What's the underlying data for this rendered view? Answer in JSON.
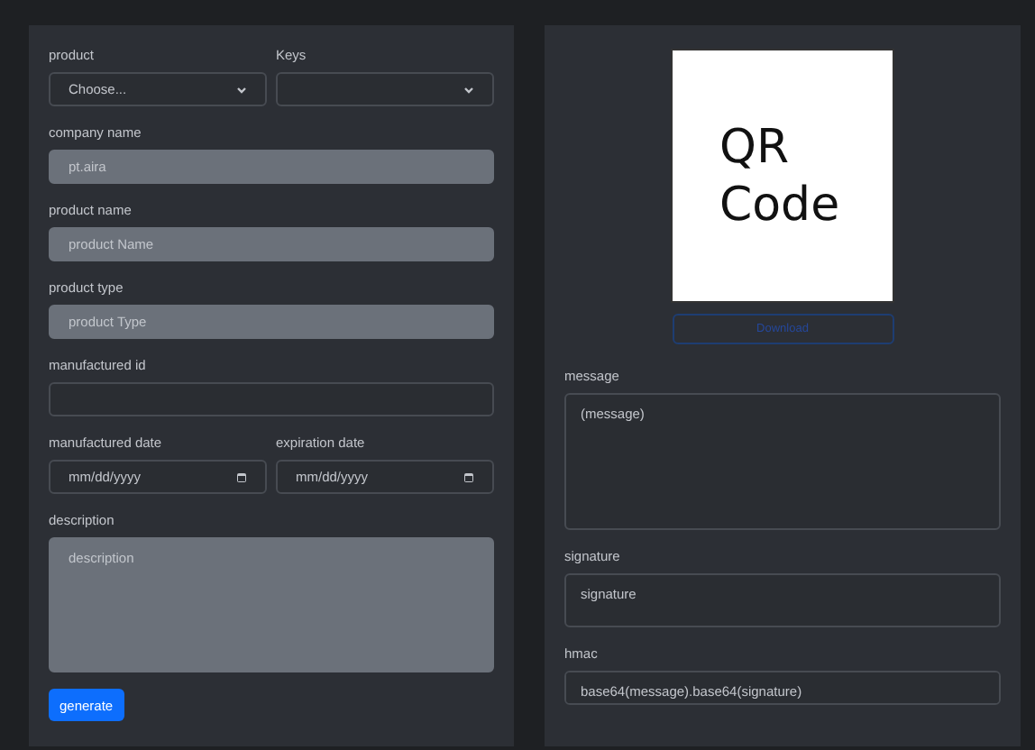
{
  "form": {
    "rows": [
      {
        "fields": [
          {
            "label": "product",
            "kind": "select",
            "value": "Choose..."
          },
          {
            "label": "Keys",
            "kind": "select"
          }
        ]
      },
      {
        "fields": [
          {
            "label": "company name",
            "kind": "input",
            "value": "pt.aira",
            "disabled": true
          }
        ]
      },
      {
        "fields": [
          {
            "label": "product name",
            "kind": "input",
            "placeholder": "product Name",
            "disabled": true
          }
        ]
      },
      {
        "fields": [
          {
            "label": "product type",
            "kind": "input",
            "placeholder": "product Type",
            "disabled": true
          }
        ]
      },
      {
        "fields": [
          {
            "label": "manufactured id",
            "kind": "input",
            "disabled": false
          }
        ]
      },
      {
        "fields": [
          {
            "label": "manufactured date",
            "kind": "date",
            "placeholder": "mm/dd/yyyy"
          },
          {
            "label": "expiration date",
            "kind": "date",
            "placeholder": "mm/dd/yyyy"
          }
        ]
      },
      {
        "fields": [
          {
            "label": "description",
            "kind": "textarea",
            "placeholder": "description",
            "disabled": true
          }
        ]
      }
    ],
    "button": "generate"
  },
  "output": {
    "qr_text": "QR Code",
    "download_button": "Download",
    "fields": [
      {
        "label": "message",
        "placeholder": "(message)"
      },
      {
        "label": "signature",
        "placeholder": "signature"
      },
      {
        "label": "hmac",
        "placeholder": "base64(message).base64(signature)"
      }
    ]
  }
}
